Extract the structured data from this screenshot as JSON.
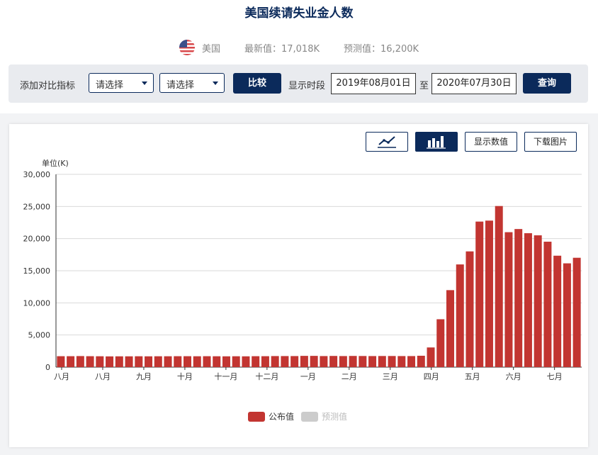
{
  "title": "美国续请失业金人数",
  "meta": {
    "country": "美国",
    "latest_label": "最新值：",
    "latest_value": "17,018K",
    "forecast_label": "预测值：",
    "forecast_value": "16,200K"
  },
  "toolbar": {
    "compare_label": "添加对比指标",
    "select1": "请选择",
    "select2": "请选择",
    "compare_button": "比较",
    "period_label": "显示时段",
    "start_date": "2019年08月01日",
    "to_label": "至",
    "end_date": "2020年07月30日",
    "query_button": "查询"
  },
  "card": {
    "line_icon": "line-chart-icon",
    "bar_icon": "bar-chart-icon",
    "show_values_button": "显示数值",
    "download_button": "下载图片",
    "unit_label": "单位(K)"
  },
  "legend": {
    "published": "公布值",
    "forecast": "预测值"
  },
  "colors": {
    "navy": "#0b2a5b",
    "bar": "#c23531",
    "forecast": "#cccccc"
  },
  "chart_data": {
    "type": "bar",
    "ylabel": "单位(K)",
    "ylim": [
      0,
      30000
    ],
    "yticks": [
      0,
      5000,
      10000,
      15000,
      20000,
      25000,
      30000
    ],
    "ytick_labels": [
      "0",
      "5,000",
      "10,000",
      "15,000",
      "20,000",
      "25,000",
      "30,000"
    ],
    "month_labels": [
      "八月",
      "八月",
      "九月",
      "十月",
      "十一月",
      "十二月",
      "一月",
      "二月",
      "三月",
      "四月",
      "五月",
      "六月",
      "七月"
    ],
    "series": [
      {
        "name": "公布值",
        "values": [
          1700,
          1700,
          1720,
          1700,
          1690,
          1670,
          1680,
          1680,
          1690,
          1680,
          1690,
          1690,
          1700,
          1700,
          1690,
          1700,
          1690,
          1680,
          1690,
          1680,
          1700,
          1700,
          1720,
          1720,
          1720,
          1750,
          1750,
          1720,
          1740,
          1720,
          1740,
          1730,
          1720,
          1730,
          1730,
          1720,
          1720,
          1770,
          3060,
          7450,
          11980,
          15980,
          18010,
          22650,
          22800,
          25070,
          21000,
          21490,
          20840,
          20510,
          19520,
          17340,
          16150,
          17018
        ]
      }
    ],
    "grid": true,
    "legend_position": "bottom-center"
  }
}
